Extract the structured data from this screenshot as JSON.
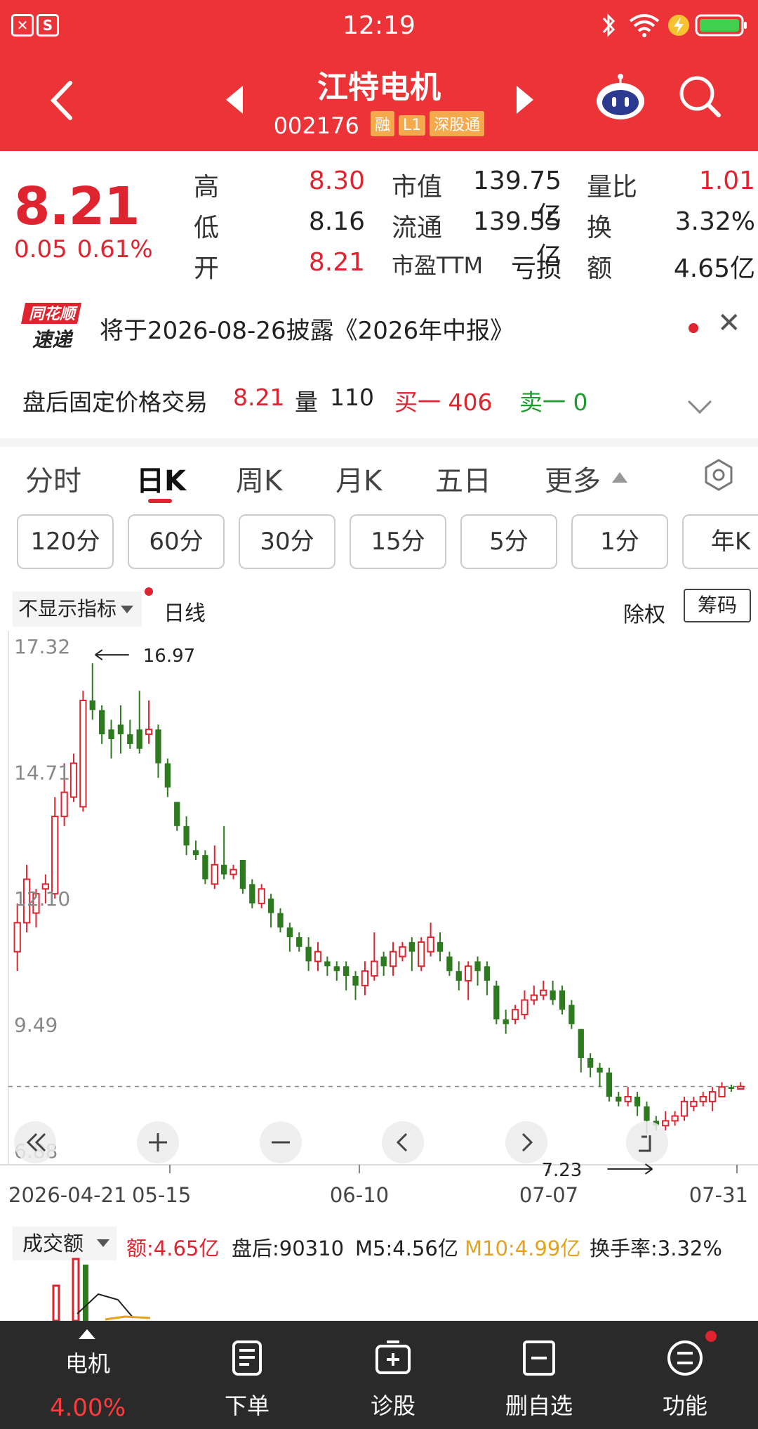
{
  "status_bar": {
    "time": "12:19"
  },
  "header": {
    "title": "江特电机",
    "code": "002176",
    "tags": [
      "融",
      "L1",
      "深股通"
    ]
  },
  "quote": {
    "price": "8.21",
    "change": "0.05",
    "change_pct": "0.61%",
    "high_label": "高",
    "high": "8.30",
    "low_label": "低",
    "low": "8.16",
    "open_label": "开",
    "open": "8.21",
    "mktcap_label": "市值",
    "mktcap": "139.75亿",
    "float_label": "流通",
    "float": "139.55亿",
    "pe_label": "市盈TTM",
    "pe": "亏损",
    "volratio_label": "量比",
    "volratio": "1.01",
    "turnover_label": "换",
    "turnover": "3.32%",
    "amount_label": "额",
    "amount": "4.65亿"
  },
  "announcement": {
    "logo_top": "同花顺",
    "logo_bottom": "速递",
    "text": "将于2026-08-26披露《2026年中报》"
  },
  "after_hours": {
    "label": "盘后固定价格交易",
    "price": "8.21",
    "vol_label": "量",
    "vol": "110",
    "buy1": "买一 406",
    "sell1": "卖一 0"
  },
  "tabs": [
    "分时",
    "日K",
    "周K",
    "月K",
    "五日",
    "更多"
  ],
  "active_tab": "日K",
  "periods": [
    "120分",
    "60分",
    "30分",
    "15分",
    "5分",
    "1分",
    "年K"
  ],
  "indicator": {
    "select": "不显示指标",
    "line": "日线",
    "exright": "除权",
    "chips": "筹码"
  },
  "chart_data": {
    "type": "candlestick",
    "yticks": [
      "17.32",
      "14.71",
      "12.10",
      "9.49",
      "6.88"
    ],
    "xticks": [
      "2026-04-21",
      "05-15",
      "06-10",
      "07-07",
      "07-31"
    ],
    "max_label": "16.97",
    "min_label": "7.23",
    "last_close": 8.21,
    "ylim": [
      6.88,
      17.32
    ],
    "up_color": "#e0242f",
    "down_color": "#2d7a1f",
    "candles": [
      [
        11.0,
        11.6,
        12.0,
        10.6
      ],
      [
        11.6,
        12.5,
        12.8,
        11.4
      ],
      [
        11.8,
        12.2,
        12.3,
        11.5
      ],
      [
        12.3,
        12.4,
        12.6,
        12.0
      ],
      [
        12.2,
        13.8,
        14.2,
        12.1
      ],
      [
        13.8,
        14.3,
        14.9,
        13.6
      ],
      [
        14.2,
        14.9,
        15.1,
        14.1
      ],
      [
        14.0,
        16.2,
        16.4,
        13.9
      ],
      [
        16.2,
        16.0,
        16.97,
        15.8
      ],
      [
        16.0,
        15.5,
        16.1,
        15.3
      ],
      [
        15.6,
        15.4,
        15.8,
        15.0
      ],
      [
        15.7,
        15.5,
        16.1,
        15.1
      ],
      [
        15.5,
        15.3,
        15.8,
        15.2
      ],
      [
        15.6,
        15.2,
        16.4,
        15.1
      ],
      [
        15.5,
        15.6,
        16.2,
        15.3
      ],
      [
        15.6,
        14.9,
        15.7,
        14.6
      ],
      [
        14.9,
        14.4,
        15.0,
        14.2
      ],
      [
        14.1,
        13.6,
        14.1,
        13.5
      ],
      [
        13.6,
        13.2,
        13.8,
        13.0
      ],
      [
        13.1,
        13.0,
        13.3,
        12.9
      ],
      [
        13.0,
        12.5,
        13.1,
        12.4
      ],
      [
        12.4,
        12.8,
        13.2,
        12.3
      ],
      [
        12.8,
        12.6,
        13.6,
        12.5
      ],
      [
        12.6,
        12.7,
        12.8,
        12.5
      ],
      [
        12.9,
        12.3,
        12.9,
        12.2
      ],
      [
        12.4,
        12.0,
        12.5,
        11.9
      ],
      [
        12.0,
        12.3,
        12.4,
        11.9
      ],
      [
        12.1,
        11.8,
        12.2,
        11.5
      ],
      [
        11.8,
        11.5,
        11.9,
        11.4
      ],
      [
        11.5,
        11.3,
        11.6,
        11.0
      ],
      [
        11.3,
        11.1,
        11.4,
        11.0
      ],
      [
        11.1,
        10.8,
        11.3,
        10.6
      ],
      [
        10.8,
        11.0,
        11.2,
        10.6
      ],
      [
        10.8,
        10.7,
        10.9,
        10.5
      ],
      [
        10.7,
        10.6,
        10.8,
        10.4
      ],
      [
        10.7,
        10.5,
        10.8,
        10.2
      ],
      [
        10.5,
        10.3,
        10.6,
        10.0
      ],
      [
        10.3,
        10.6,
        10.8,
        10.1
      ],
      [
        10.5,
        10.8,
        11.4,
        10.4
      ],
      [
        10.9,
        10.7,
        11.0,
        10.5
      ],
      [
        10.7,
        11.0,
        11.2,
        10.5
      ],
      [
        10.9,
        11.1,
        11.2,
        10.8
      ],
      [
        11.2,
        11.0,
        11.3,
        10.6
      ],
      [
        10.7,
        11.2,
        11.3,
        10.6
      ],
      [
        11.0,
        11.3,
        11.6,
        10.9
      ],
      [
        11.2,
        11.0,
        11.4,
        10.8
      ],
      [
        10.9,
        10.6,
        11.0,
        10.5
      ],
      [
        10.6,
        10.4,
        10.8,
        10.2
      ],
      [
        10.4,
        10.7,
        10.8,
        10.0
      ],
      [
        10.8,
        10.6,
        10.9,
        10.3
      ],
      [
        10.7,
        10.4,
        10.8,
        10.1
      ],
      [
        10.3,
        9.6,
        10.4,
        9.5
      ],
      [
        9.6,
        9.5,
        9.8,
        9.3
      ],
      [
        9.6,
        9.8,
        9.9,
        9.5
      ],
      [
        9.7,
        10.0,
        10.2,
        9.6
      ],
      [
        10.0,
        10.1,
        10.3,
        9.9
      ],
      [
        10.1,
        10.2,
        10.4,
        10.0
      ],
      [
        10.2,
        10.0,
        10.4,
        9.9
      ],
      [
        10.2,
        9.8,
        10.3,
        9.7
      ],
      [
        9.9,
        9.5,
        10.0,
        9.4
      ],
      [
        9.4,
        8.8,
        9.4,
        8.5
      ],
      [
        8.8,
        8.6,
        8.9,
        8.4
      ],
      [
        8.6,
        8.5,
        8.7,
        8.2
      ],
      [
        8.5,
        8.0,
        8.6,
        7.9
      ],
      [
        8.0,
        7.9,
        8.1,
        7.8
      ],
      [
        7.9,
        8.0,
        8.2,
        7.8
      ],
      [
        8.0,
        7.8,
        8.1,
        7.6
      ],
      [
        7.8,
        7.5,
        7.9,
        7.23
      ],
      [
        7.5,
        7.4,
        7.6,
        7.3
      ],
      [
        7.4,
        7.5,
        7.7,
        7.3
      ],
      [
        7.5,
        7.6,
        7.7,
        7.4
      ],
      [
        7.6,
        7.9,
        8.0,
        7.5
      ],
      [
        7.8,
        7.9,
        8.0,
        7.7
      ],
      [
        7.9,
        8.0,
        8.1,
        7.8
      ],
      [
        7.9,
        8.1,
        8.2,
        7.7
      ],
      [
        8.0,
        8.2,
        8.3,
        8.0
      ],
      [
        8.2,
        8.16,
        8.25,
        8.1
      ],
      [
        8.16,
        8.21,
        8.3,
        8.16
      ]
    ]
  },
  "volume": {
    "select": "成交额",
    "amount": "额:4.65亿",
    "after": "盘后:90310",
    "m5": "M5:4.56亿",
    "m10": "M10:4.99亿",
    "turnover": "换手率:3.32%"
  },
  "bottom_nav": {
    "stock_label": "电机",
    "stock_pct": "4.00%",
    "order": "下单",
    "diagnose": "诊股",
    "remove": "删自选",
    "func": "功能"
  }
}
